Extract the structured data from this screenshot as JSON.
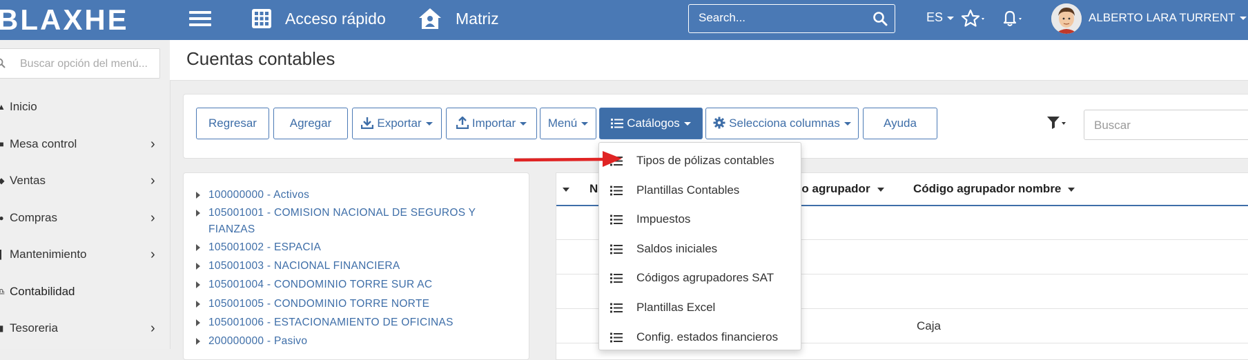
{
  "colors": {
    "primary": "#4a79b5",
    "button_primary": "#3e6ea8",
    "annotation_arrow": "#e02424"
  },
  "header": {
    "logo": "BLAXHE",
    "quick_access": "Acceso rápido",
    "home": "Matriz",
    "search_placeholder": "Search...",
    "language": "ES",
    "user_name": "ALBERTO LARA TURRENT"
  },
  "sidebar": {
    "search_placeholder": "Buscar opción del menú...",
    "items": [
      {
        "label": "Inicio",
        "icon": "home-icon",
        "has_submenu": false
      },
      {
        "label": "Mesa control",
        "icon": "dashboard-icon",
        "has_submenu": true
      },
      {
        "label": "Ventas",
        "icon": "tag-icon",
        "has_submenu": true
      },
      {
        "label": "Compras",
        "icon": "cart-icon",
        "has_submenu": true
      },
      {
        "label": "Mantenimiento",
        "icon": "wrench-icon",
        "has_submenu": true
      },
      {
        "label": "Contabilidad",
        "icon": "scale-icon",
        "has_submenu": false,
        "active": true
      },
      {
        "label": "Tesoreria",
        "icon": "money-icon",
        "has_submenu": true
      }
    ]
  },
  "page": {
    "title": "Cuentas contables"
  },
  "toolbar": {
    "back": "Regresar",
    "add": "Agregar",
    "export": "Exportar",
    "import": "Importar",
    "menu": "Menú",
    "catalogs": "Catálogos",
    "columns": "Selecciona columnas",
    "help": "Ayuda",
    "search_placeholder": "Buscar"
  },
  "catalog_menu": [
    "Tipos de pólizas contables",
    "Plantillas Contables",
    "Impuestos",
    "Saldos iniciales",
    "Códigos agrupadores SAT",
    "Plantillas Excel",
    "Config. estados financieros"
  ],
  "tree": [
    "100000000 - Activos",
    "105001001 - COMISION NACIONAL DE SEGUROS Y FIANZAS",
    "105001002 - ESPACIA",
    "105001003 - NACIONAL FINANCIERA",
    "105001004 - CONDOMINIO TORRE SUR AC",
    "105001005 - CONDOMINIO TORRE NORTE",
    "105001006 - ESTACIONAMIENTO DE OFICINAS",
    "200000000 - Pasivo"
  ],
  "table": {
    "headers": [
      "N",
      "go agrupador",
      "Código agrupador nombre"
    ],
    "rows": [
      {
        "grouping_name": ""
      },
      {
        "grouping_name": ""
      },
      {
        "grouping_name": ""
      },
      {
        "grouping_name": "Caja"
      }
    ]
  }
}
